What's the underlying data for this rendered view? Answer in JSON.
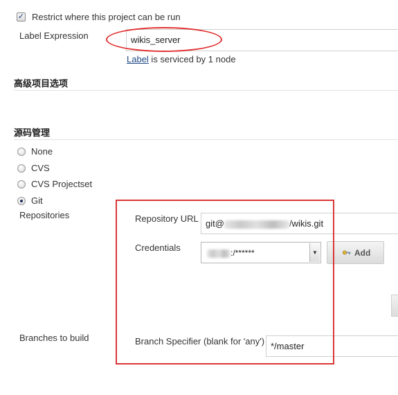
{
  "restrict": {
    "checkbox_label": "Restrict where this project can be run",
    "label_expression_label": "Label Expression",
    "label_expression_value": "wikis_server",
    "serviced_link": "Label",
    "serviced_text": " is serviced by 1 node"
  },
  "advanced": {
    "heading": "高级项目选项"
  },
  "scm": {
    "heading": "源码管理",
    "options": [
      "None",
      "CVS",
      "CVS Projectset",
      "Git"
    ],
    "selected": "Git",
    "repositories_label": "Repositories",
    "repo_url_label": "Repository URL",
    "repo_url_prefix": "git@",
    "repo_url_suffix": "/wikis.git",
    "credentials_label": "Credentials",
    "credentials_value": ":/******",
    "add_button": "Add",
    "branches_label": "Branches to build",
    "branch_specifier_label": "Branch Specifier (blank for 'any')",
    "branch_specifier_value": "*/master"
  },
  "colors": {
    "annotation_red": "#d93535",
    "link_blue": "#204a87"
  }
}
